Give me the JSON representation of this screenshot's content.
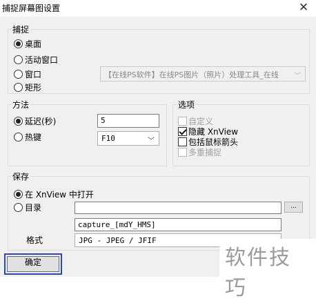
{
  "window": {
    "title": "捕捉屏幕图设置",
    "close_glyph": "✕"
  },
  "capture_group": {
    "legend": "捕捉",
    "options": [
      {
        "label": "桌面",
        "checked": true
      },
      {
        "label": "活动窗口",
        "checked": false
      },
      {
        "label": "窗口",
        "checked": false
      },
      {
        "label": "矩形",
        "checked": false
      }
    ],
    "window_select_value": "【在线PS软件】在线PS图片（照片）处理工具_在线"
  },
  "method_group": {
    "legend": "方法",
    "delay_label": "延迟(秒)",
    "delay_value": "5",
    "hotkey_label": "热键",
    "hotkey_value": "F10"
  },
  "options_group": {
    "legend": "选项",
    "items": [
      {
        "label": "自定义",
        "checked": false,
        "disabled": true
      },
      {
        "label": "隐藏 XnView",
        "checked": true,
        "disabled": false
      },
      {
        "label": "包括鼠标箭头",
        "checked": false,
        "disabled": false
      },
      {
        "label": "多重捕捉",
        "checked": false,
        "disabled": true
      }
    ]
  },
  "save_group": {
    "legend": "保存",
    "open_in_xnview_label": "在 XnView 中打开",
    "directory_label": "目录",
    "directory_value": "",
    "browse_label": "...",
    "filename_value": "capture_[mdY_HMS]",
    "format_label": "格式",
    "format_value": "JPG - JPEG / JFIF"
  },
  "ok_button_label": "确定",
  "watermark_text": "软件技巧"
}
